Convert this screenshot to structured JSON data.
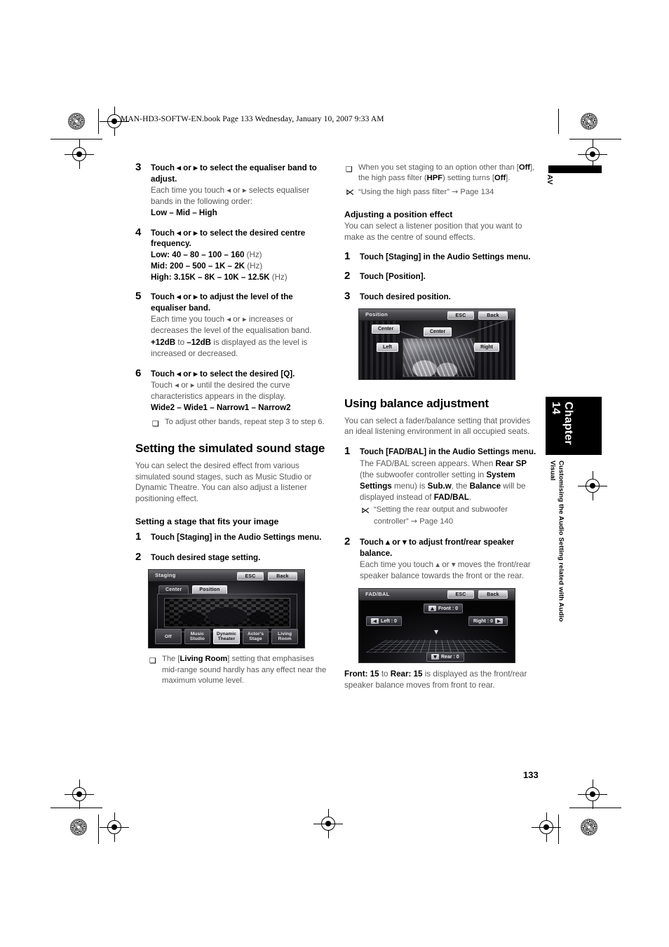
{
  "running_header": "MAN-HD3-SOFTW-EN.book  Page 133  Wednesday, January 10, 2007  9:33 AM",
  "folio": "133",
  "margin_tab": {
    "av_label": "AV",
    "chapter_label": "Chapter 14",
    "chapter_description": "Customising the Audio Setting related with Audio Visual"
  },
  "left_column": {
    "step3": {
      "num": "3",
      "title": "Touch ◂ or ▸ to select the equaliser band to adjust.",
      "body": "Each time you touch ◂ or ▸ selects equaliser bands in the following order:",
      "values": "Low – Mid – High"
    },
    "step4": {
      "num": "4",
      "title": "Touch ◂ or ▸ to select the desired centre frequency.",
      "low": "Low: 40 – 80 – 100 – 160",
      "low_unit": "(Hz)",
      "mid": "Mid: 200 – 500 – 1K – 2K",
      "mid_unit": "(Hz)",
      "high": "High: 3.15K – 8K – 10K – 12.5K",
      "high_unit": "(Hz)"
    },
    "step5": {
      "num": "5",
      "title": "Touch ◂ or ▸ to adjust the level of the equaliser band.",
      "body1": "Each time you touch ◂ or ▸ increases or decreases the level of the equalisation band.",
      "body2_bold1": "+12dB",
      "body2_mid": " to ",
      "body2_bold2": "–12dB",
      "body2_rest": " is displayed as the level is increased or decreased."
    },
    "step6": {
      "num": "6",
      "title": "Touch ◂ or ▸ to select the desired [Q].",
      "body": "Touch ◂ or ▸ until the desired the curve characteristics appears in the display.",
      "values": "Wide2 – Wide1 – Narrow1 – Narrow2",
      "note": "To adjust other bands, repeat step 3 to step 6."
    },
    "section_heading": "Setting the simulated sound stage",
    "section_lead": "You can select the desired effect from various simulated sound stages, such as Music Studio or Dynamic Theatre. You can also adjust a listener positioning effect.",
    "sub_heading": "Setting a stage that fits your image",
    "stage_step1": {
      "num": "1",
      "title": "Touch [Staging] in the Audio Settings menu."
    },
    "stage_step2": {
      "num": "2",
      "title": "Touch desired stage setting."
    },
    "staging_screen": {
      "title": "Staging",
      "esc": "ESC",
      "back": "Back",
      "tabs": [
        {
          "label": "Center",
          "active": false
        },
        {
          "label": "Position",
          "active": true
        }
      ],
      "stage_buttons": [
        {
          "line1": "Off",
          "line2": "",
          "selected": false
        },
        {
          "line1": "Music",
          "line2": "Studio",
          "selected": false
        },
        {
          "line1": "Dynamic",
          "line2": "Theater",
          "selected": true
        },
        {
          "line1": "Actor's",
          "line2": "Stage",
          "selected": false
        },
        {
          "line1": "Living",
          "line2": "Room",
          "selected": false
        }
      ]
    },
    "stage_note_pre": "The [",
    "stage_note_bold": "Living Room",
    "stage_note_post": "] setting that emphasises mid-range sound hardly has any effect near the maximum volume level."
  },
  "right_column": {
    "hpf_note": {
      "pre": "When you set staging to an option other than [",
      "b1": "Off",
      "mid1": "], the high pass filter (",
      "b2": "HPF",
      "mid2": ") setting turns [",
      "b3": "Off",
      "post": "]."
    },
    "hpf_ref": {
      "text": "“Using the high pass filter”",
      "arrow": "→",
      "page": "Page 134"
    },
    "position_heading": "Adjusting a position effect",
    "position_lead": "You can select a listener position that you want to make as the centre of sound effects.",
    "pos_step1": {
      "num": "1",
      "title": "Touch [Staging] in the Audio Settings menu."
    },
    "pos_step2": {
      "num": "2",
      "title": "Touch [Position]."
    },
    "pos_step3": {
      "num": "3",
      "title": "Touch desired position."
    },
    "position_screen": {
      "title": "Position",
      "esc": "ESC",
      "back": "Back",
      "tab_center": "Center",
      "btn_center": "Center",
      "btn_left": "Left",
      "btn_right": "Right"
    },
    "balance_heading": "Using balance adjustment",
    "balance_lead": "You can select a fader/balance setting that provides an ideal listening environment in all occupied seats.",
    "bal_step1": {
      "num": "1",
      "title": "Touch [FAD/BAL] in the Audio Settings menu.",
      "body_a": "The FAD/BAL screen appears. When ",
      "b1": "Rear SP",
      "body_b": " (the subwoofer controller setting in ",
      "b2": "System Settings",
      "body_c": " menu) is ",
      "b3": "Sub.w",
      "body_d": ", the ",
      "b4": "Balance",
      "body_e": " will be displayed instead of ",
      "b5": "FAD/BAL",
      "body_f": "."
    },
    "bal_ref": {
      "text": "“Setting the rear output and subwoofer controller”",
      "arrow": "→",
      "page": "Page 140"
    },
    "bal_step2": {
      "num": "2",
      "title": "Touch ▴ or ▾ to adjust front/rear speaker balance.",
      "body": "Each time you touch ▴ or ▾ moves the front/rear speaker balance towards the front or the rear."
    },
    "fadbal_screen": {
      "title": "FAD/BAL",
      "esc": "ESC",
      "back": "Back",
      "front": "Front : 0",
      "rear": "Rear : 0",
      "left": "Left : 0",
      "right": "Right : 0"
    },
    "bal_caption": {
      "b1": "Front: 15",
      "mid": " to ",
      "b2": "Rear: 15",
      "post": " is displayed as the front/rear speaker balance moves from front to rear."
    }
  }
}
